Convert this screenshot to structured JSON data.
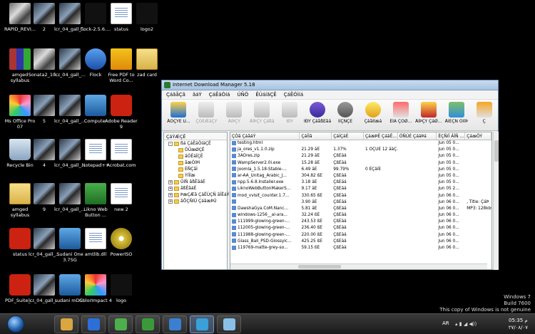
{
  "desktop": {
    "icons": [
      {
        "label": "RAPID_REVI...",
        "kind": "photo2"
      },
      {
        "label": "2",
        "kind": "photo"
      },
      {
        "label": "lcr_04_gall_...",
        "kind": "photo"
      },
      {
        "label": "flock-2.5.6....",
        "kind": "logo"
      },
      {
        "label": "status",
        "kind": "doc"
      },
      {
        "label": "logo2",
        "kind": "logo"
      },
      {
        "label": "amged syllabus",
        "kind": "rar"
      },
      {
        "label": "Sonata2_10...",
        "kind": "photo2"
      },
      {
        "label": "lcr_04_gall_...",
        "kind": "photo"
      },
      {
        "label": "Flock",
        "kind": "blue"
      },
      {
        "label": "Free PDF to Word Co...",
        "kind": "pdfw"
      },
      {
        "label": "zad card",
        "kind": "folder"
      },
      {
        "label": "Ms Office Pro 07",
        "kind": "multi"
      },
      {
        "label": "5",
        "kind": "photo"
      },
      {
        "label": "lcr_04_gall_...",
        "kind": "photo"
      },
      {
        "label": "Computer",
        "kind": "monitor"
      },
      {
        "label": "Adobe Reader 9",
        "kind": "pdfr"
      },
      {
        "label": "Recycle Bin",
        "kind": "trash"
      },
      {
        "label": "4",
        "kind": "photo"
      },
      {
        "label": "lcr_04_gall_...",
        "kind": "photo"
      },
      {
        "label": "Notepad++",
        "kind": "doc"
      },
      {
        "label": "Acrobat.com",
        "kind": "doc"
      },
      {
        "label": "amged syllabus",
        "kind": "folder"
      },
      {
        "label": "9",
        "kind": "photo"
      },
      {
        "label": "lcr_04_gall_...",
        "kind": "photo"
      },
      {
        "label": "Likno Web Button ...",
        "kind": "green"
      },
      {
        "label": "new 2",
        "kind": "doc"
      },
      {
        "label": "status",
        "kind": "pdfr"
      },
      {
        "label": "lcr_04_gall_...",
        "kind": "photo"
      },
      {
        "label": "Sudani One 3.75G",
        "kind": "monitor"
      },
      {
        "label": "amtlib.dll",
        "kind": "doc"
      },
      {
        "label": "PowerISO",
        "kind": "cd"
      },
      {
        "label": "PDF_Suite_...",
        "kind": "pdfr"
      },
      {
        "label": "lcr_04_gall_...",
        "kind": "photo"
      },
      {
        "label": "sudani mDSL",
        "kind": "monitor"
      },
      {
        "label": "ColorImpact 4",
        "kind": "multi"
      },
      {
        "label": "logo",
        "kind": "logo"
      }
    ]
  },
  "watermark": {
    "line1": "Windows 7",
    "line2": "Build 7600",
    "line3": "This copy of Windows is not genuine"
  },
  "idm": {
    "title": "Internet Download Manager 5.18",
    "menu": [
      "ÇáãåÇã",
      "ãáÝ",
      "ÇáÊäÒíá",
      "ÚÑÖ",
      "ÊÚáíãÇÊ",
      "ÇáÊÓÌíá"
    ],
    "toolbar": [
      {
        "label": "ÅÖÇÝÉ Ú...",
        "disabled": false,
        "icon": "t1"
      },
      {
        "label": "ÇÓÊÆäÇÝ",
        "disabled": true,
        "icon": "t2"
      },
      {
        "label": "ÅíÞÇÝ",
        "disabled": true,
        "icon": "t2"
      },
      {
        "label": "ÅíÞÇÝ Çáßá",
        "disabled": true,
        "icon": "t2"
      },
      {
        "label": "ÍÐÝ",
        "disabled": true,
        "icon": "t2"
      },
      {
        "label": "ÍÐÝ ÇáãßÊãá",
        "disabled": false,
        "icon": "t3"
      },
      {
        "label": "ÎíÇÑÇÊ",
        "disabled": false,
        "icon": "t4"
      },
      {
        "label": "ÇáãÌÏæá",
        "disabled": false,
        "icon": "t5"
      },
      {
        "label": "ÈÏÁ ÇÕØ...",
        "disabled": false,
        "icon": "t6"
      },
      {
        "label": "ÅíÞÇÝ ÇáØ...",
        "disabled": false,
        "icon": "t7"
      },
      {
        "label": "ÅÎÈÇÑ ÕÏíÞ",
        "disabled": false,
        "icon": "t8"
      },
      {
        "label": "Ç",
        "disabled": false,
        "icon": "t9"
      }
    ],
    "tree": {
      "header": "ÇáÝÆÇÊ",
      "nodes": [
        {
          "label": "ßá ÇáÊäÒíáÇÊ",
          "level": 0,
          "exp": "-"
        },
        {
          "label": "ÖÛæØÇÊ",
          "level": 1,
          "exp": ""
        },
        {
          "label": "ãÓÊäÏÇÊ",
          "level": 1,
          "exp": ""
        },
        {
          "label": "ãæÓíÞì",
          "level": 1,
          "exp": ""
        },
        {
          "label": "ÈÑÇãÌ",
          "level": 1,
          "exp": ""
        },
        {
          "label": "ÝíÏíæ",
          "level": 1,
          "exp": ""
        },
        {
          "label": "ÛíÑ ãßÊãáÉ",
          "level": 0,
          "exp": "+"
        },
        {
          "label": "ãßÊãáÉ",
          "level": 0,
          "exp": "+"
        },
        {
          "label": "ÞæÇÆã ÇäÊÙÇÑ ãÎÊáÝÉ",
          "level": 0,
          "exp": "+"
        },
        {
          "label": "ãÔÇÑíÚ ÇáãæÞÚ",
          "level": 0,
          "exp": "+"
        }
      ]
    },
    "list": {
      "headers": [
        "ÇÓã ÇáãáÝ",
        "ÇáÍÌã",
        "ÇáÍÇáÉ",
        "ÇáæÞÊ ÇáãÊ...",
        "ÓÑÚÉ ÇáäÞá",
        "ÊÇÑíÎ ÂÎÑ ...",
        "ÇáæÕÝ"
      ],
      "rows": [
        [
          "testing.html",
          "",
          "",
          "",
          "",
          "Jun 05 0...",
          ""
        ],
        [
          "ja_ores_v1.1.0.zip",
          "21.29 ãÈ",
          "1.37%",
          "1 ÓÇÚÉ 12 ãäÇ...",
          "",
          "Jun 05 0...",
          ""
        ],
        [
          "3AOres.zip",
          "21.29 ãÈ",
          "ÇßÊãá",
          "",
          "",
          "Jun 05 0...",
          ""
        ],
        [
          "WampServer2.0i.exe",
          "15.28 ãÈ",
          "ÇßÊãá",
          "",
          "",
          "Jun 05 0...",
          ""
        ],
        [
          "Joomla_1.5.18-Stable-...",
          "6.49 ãÈ",
          "99.79%",
          "0 ËÇäíÉ",
          "",
          "Jun 05 0...",
          ""
        ],
        [
          "ar-AA_Unitag_Arabic_J...",
          "304.82 ßÈ",
          "ÇßÊãá",
          "",
          "",
          "Jun 05 0...",
          ""
        ],
        [
          "npp.5.6.8.Installer.exe",
          "3.18 ãÈ",
          "ÇßÊãá",
          "",
          "",
          "Jun 05 0...",
          ""
        ],
        [
          "LiknoWebButtonMakerS...",
          "9.17 ãÈ",
          "ÇßÊãá",
          "",
          "",
          "Jun 05 2...",
          ""
        ],
        [
          "mod_vvisit_counter.1.7...",
          "330.65 ßÈ",
          "ÇßÊãá",
          "",
          "",
          "Jun 06 0...",
          ""
        ],
        [
          "",
          "3.90 ãÈ",
          "ÇßÊãá",
          "",
          "",
          "Jun 06 0...",
          ", Title: ÇáÞ"
        ],
        [
          "DawshaGya.CoM.Nanc...",
          "5.81 ãÈ",
          "ÇßÊãá",
          "",
          "",
          "Jun 06 0...",
          "MP3: 128kbs,"
        ],
        [
          "windows-1256__al-ara...",
          "32.24 ßÈ",
          "ÇßÊãá",
          "",
          "",
          "Jun 06 0...",
          ""
        ],
        [
          "111999-glowing-green-...",
          "243.53 ßÈ",
          "ÇßÊãá",
          "",
          "",
          "Jun 06 0...",
          ""
        ],
        [
          "112005-glowing-green-...",
          "236.40 ßÈ",
          "ÇßÊãá",
          "",
          "",
          "Jun 06 0...",
          ""
        ],
        [
          "111988-glowing-green-...",
          "220.00 ßÈ",
          "ÇßÊãá",
          "",
          "",
          "Jun 06 0...",
          ""
        ],
        [
          "Glass_Ball_PSD-Glossyic...",
          "425.25 ßÈ",
          "ÇßÊãá",
          "",
          "",
          "Jun 06 0...",
          ""
        ],
        [
          "119769-matte-grey-so...",
          "59.15 ßÈ",
          "ÇßÊãá",
          "",
          "",
          "Jun 06 0...",
          ""
        ]
      ]
    }
  },
  "taskbar": {
    "buttons": [
      {
        "name": "explorer",
        "color": "#d9a640"
      },
      {
        "name": "media-player",
        "color": "#2c6fd8"
      },
      {
        "name": "messenger",
        "color": "#4cae4c"
      },
      {
        "name": "utorrent",
        "color": "#3a9a3a"
      },
      {
        "name": "network",
        "color": "#3a7fd0"
      },
      {
        "name": "idm",
        "color": "#3aa0d8"
      },
      {
        "name": "paint",
        "color": "#8ac0e8"
      }
    ],
    "lang": "AR",
    "time": "05:35 م",
    "date": "٢٧/٠٨/٠٧"
  }
}
